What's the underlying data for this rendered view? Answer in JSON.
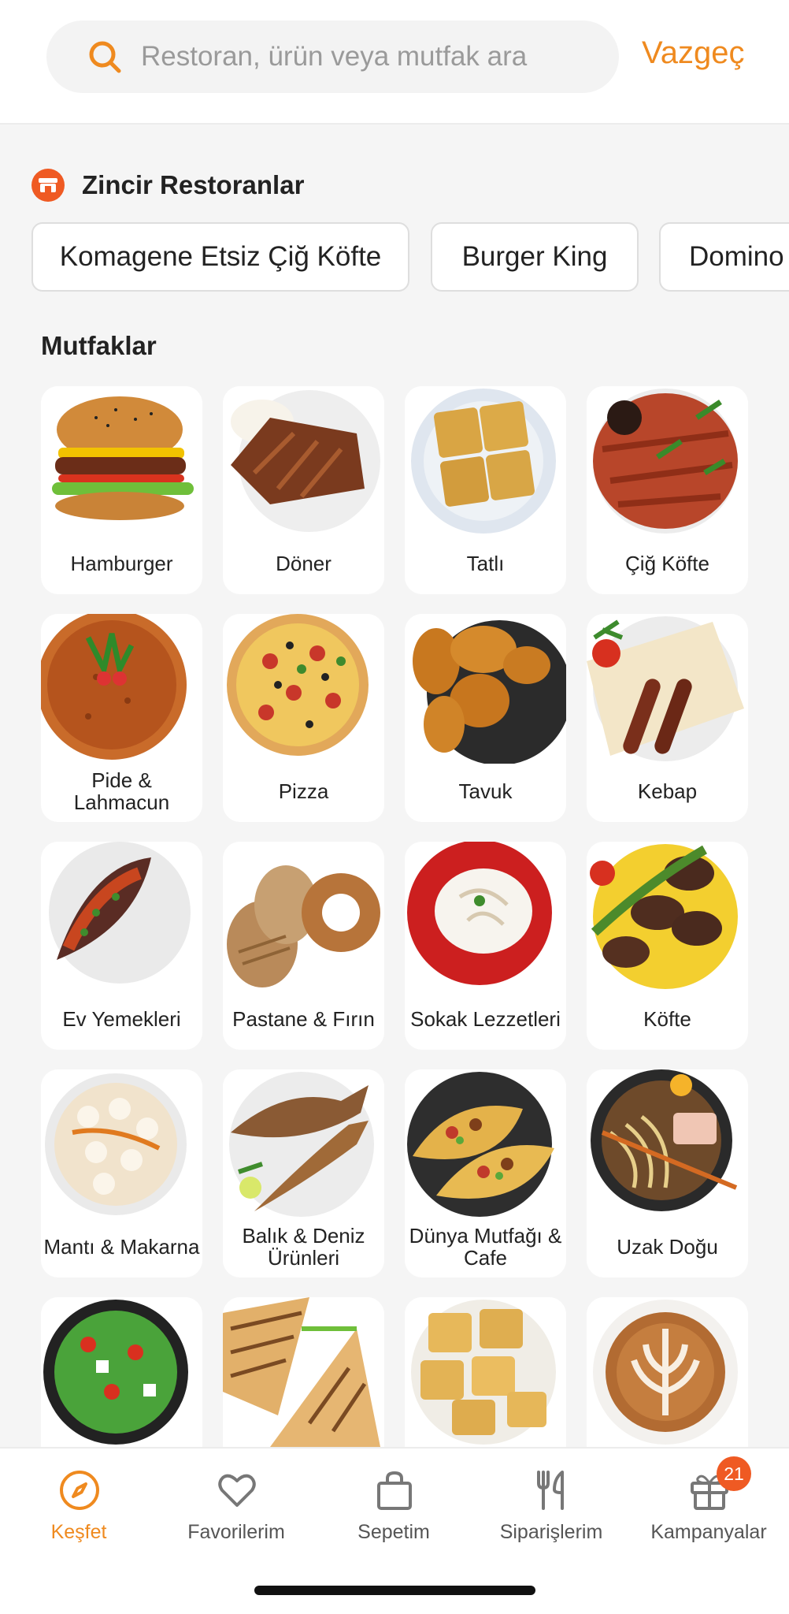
{
  "search": {
    "placeholder": "Restoran, ürün veya mutfak ara",
    "value": "",
    "cancel_label": "Vazgeç"
  },
  "chain_section": {
    "title": "Zincir Restoranlar",
    "icon": "store-icon",
    "chips": [
      "Komagene Etsiz Çiğ Köfte",
      "Burger King",
      "Domino"
    ]
  },
  "kitchens": {
    "title": "Mutfaklar",
    "items": [
      {
        "label": "Hamburger",
        "icon": "hamburger-image"
      },
      {
        "label": "Döner",
        "icon": "doner-image"
      },
      {
        "label": "Tatlı",
        "icon": "dessert-image"
      },
      {
        "label": "Çiğ Köfte",
        "icon": "cig-kofte-image"
      },
      {
        "label": "Pide & Lahmacun",
        "icon": "lahmacun-image"
      },
      {
        "label": "Pizza",
        "icon": "pizza-image"
      },
      {
        "label": "Tavuk",
        "icon": "chicken-image"
      },
      {
        "label": "Kebap",
        "icon": "kebab-image"
      },
      {
        "label": "Ev Yemekleri",
        "icon": "home-food-image"
      },
      {
        "label": "Pastane & Fırın",
        "icon": "bakery-image"
      },
      {
        "label": "Sokak Lezzetleri",
        "icon": "street-food-image"
      },
      {
        "label": "Köfte",
        "icon": "meatball-image"
      },
      {
        "label": "Mantı & Makarna",
        "icon": "manti-image"
      },
      {
        "label": "Balık & Deniz Ürünleri",
        "icon": "fish-image"
      },
      {
        "label": "Dünya Mutfağı & Cafe",
        "icon": "tacos-image"
      },
      {
        "label": "Uzak Doğu",
        "icon": "noodles-image"
      },
      {
        "label": "",
        "icon": "salad-image"
      },
      {
        "label": "",
        "icon": "sandwich-image"
      },
      {
        "label": "",
        "icon": "borek-image"
      },
      {
        "label": "",
        "icon": "coffee-image"
      }
    ]
  },
  "bottom_nav": {
    "items": [
      {
        "label": "Keşfet",
        "icon": "compass-icon",
        "active": true
      },
      {
        "label": "Favorilerim",
        "icon": "heart-icon",
        "active": false
      },
      {
        "label": "Sepetim",
        "icon": "bag-icon",
        "active": false
      },
      {
        "label": "Siparişlerim",
        "icon": "fork-knife-icon",
        "active": false
      },
      {
        "label": "Kampanyalar",
        "icon": "gift-icon",
        "active": false,
        "badge": "21"
      }
    ]
  },
  "colors": {
    "accent": "#ef8a1f",
    "badge": "#ef5a23",
    "background": "#f5f5f5"
  }
}
